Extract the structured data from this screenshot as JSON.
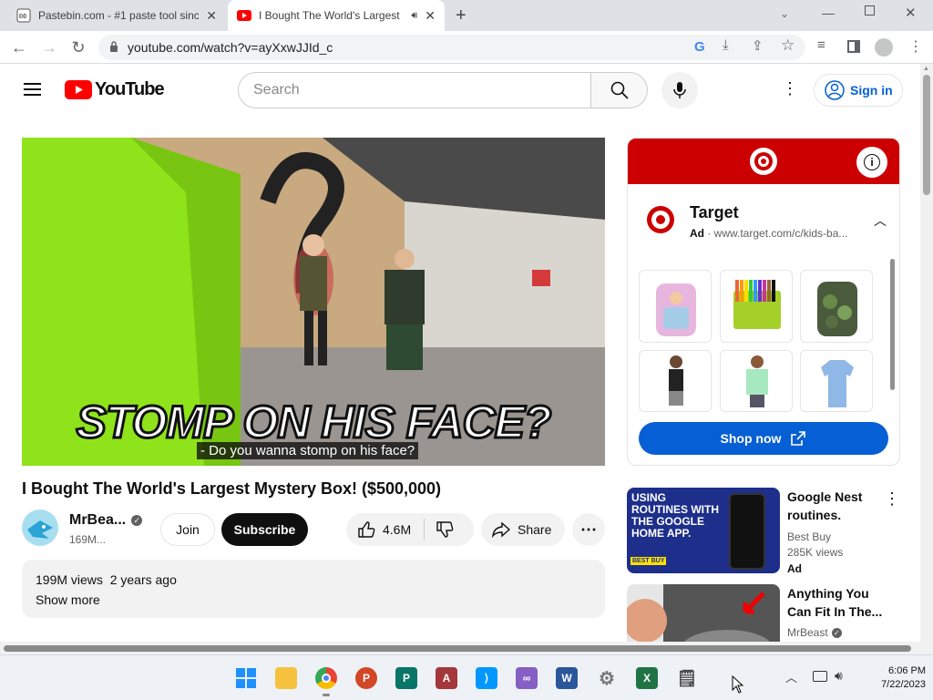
{
  "tabs": [
    {
      "title": "Pastebin.com - #1 paste tool since",
      "icon": "pastebin-icon",
      "active": false
    },
    {
      "title": "I Bought The World's Largest",
      "icon": "youtube-icon",
      "active": true
    }
  ],
  "address": {
    "url": "youtube.com/watch?v=ayXxwJJId_c"
  },
  "header": {
    "logo_text": "YouTube",
    "search_placeholder": "Search",
    "signin_label": "Sign in"
  },
  "video": {
    "caption_big": "STOMP ON HIS FACE?",
    "subtitle": "- Do you wanna stomp on his face?",
    "title": "I Bought The World's Largest Mystery Box! ($500,000)",
    "channel": "MrBea...",
    "subs": "169M...",
    "join_label": "Join",
    "subscribe_label": "Subscribe",
    "likes": "4.6M",
    "share_label": "Share",
    "views": "199M views",
    "age": "2 years ago",
    "show_more": "Show more"
  },
  "ad": {
    "brand": "Target",
    "ad_label": "Ad",
    "url": "www.target.com/c/kids-ba...",
    "cta": "Shop now",
    "accent": "#cc0000"
  },
  "recs": [
    {
      "thumb_text": "USING ROUTINES WITH THE GOOGLE HOME APP.",
      "thumb_brand": "BEST BUY",
      "title": "Google Nest routines.",
      "channel": "Best Buy",
      "views": "285K views",
      "badge": "Ad"
    },
    {
      "title": "Anything You Can Fit In The...",
      "channel": "MrBeast"
    }
  ],
  "taskbar": {
    "time": "6:06 PM",
    "date": "7/22/2023"
  }
}
